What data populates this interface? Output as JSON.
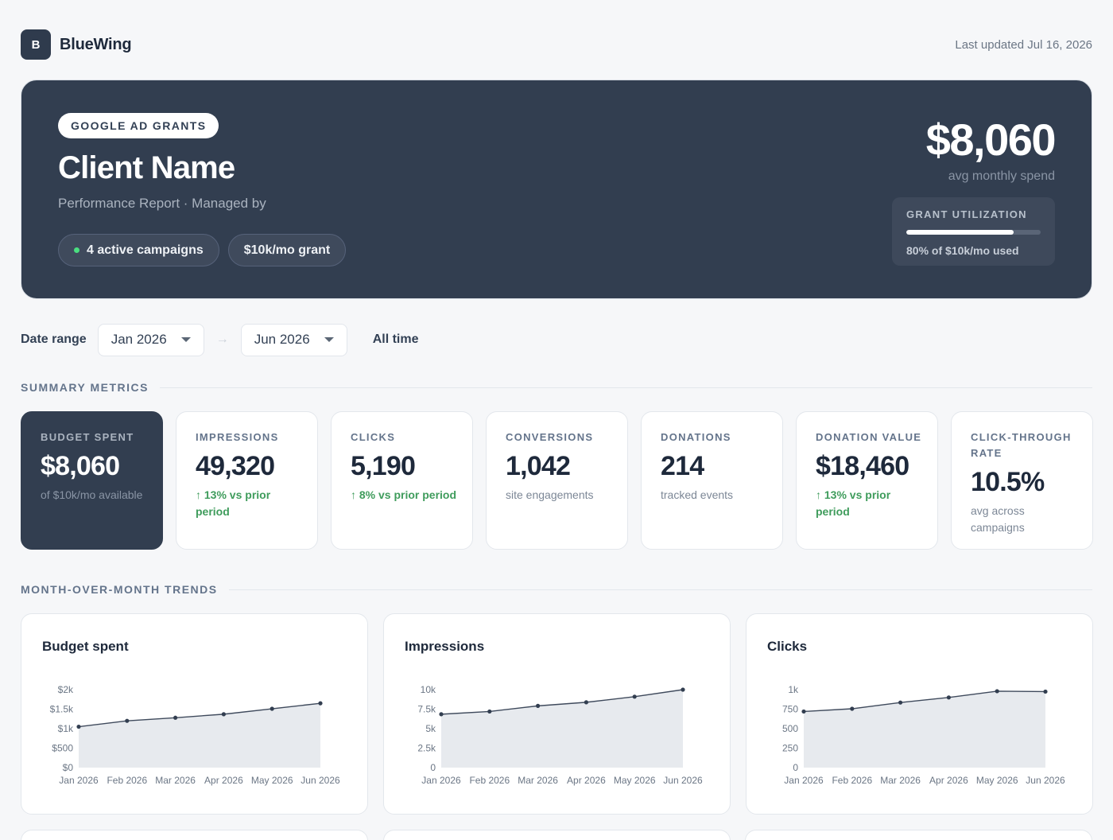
{
  "header": {
    "logo_letter": "B",
    "brand": "BlueWing",
    "last_updated": "Last updated Jul 16, 2026"
  },
  "hero": {
    "eyebrow": "GOOGLE AD GRANTS",
    "client": "Client Name",
    "subtitle": "Performance Report · Managed by",
    "pills": [
      "4 active campaigns",
      "$10k/mo grant"
    ],
    "spend_value": "$8,060",
    "spend_label": "avg monthly spend",
    "utilization": {
      "label": "GRANT UTILIZATION",
      "fraction": 0.8,
      "text": "80% of $10k/mo used"
    }
  },
  "date_range": {
    "label": "Date range",
    "from": "Jan 2026",
    "to": "Jun 2026",
    "all_time": "All time"
  },
  "sections": {
    "summary": "SUMMARY METRICS",
    "trends": "MONTH-OVER-MONTH TRENDS"
  },
  "metrics": [
    {
      "label": "BUDGET SPENT",
      "value": "$8,060",
      "note": "of $10k/mo available",
      "trend": false
    },
    {
      "label": "IMPRESSIONS",
      "value": "49,320",
      "note": "↑ 13% vs prior period",
      "trend": true
    },
    {
      "label": "CLICKS",
      "value": "5,190",
      "note": "↑ 8% vs prior period",
      "trend": true
    },
    {
      "label": "CONVERSIONS",
      "value": "1,042",
      "note": "site engagements",
      "trend": false
    },
    {
      "label": "DONATIONS",
      "value": "214",
      "note": "tracked events",
      "trend": false
    },
    {
      "label": "DONATION VALUE",
      "value": "$18,460",
      "note": "↑ 13% vs prior period",
      "trend": true
    },
    {
      "label": "CLICK-THROUGH RATE",
      "value": "10.5%",
      "note": "avg across campaigns",
      "trend": false
    }
  ],
  "chart_data": [
    {
      "type": "area",
      "title": "Budget spent",
      "categories": [
        "Jan 2026",
        "Feb 2026",
        "Mar 2026",
        "Apr 2026",
        "May 2026",
        "Jun 2026"
      ],
      "values": [
        1050,
        1200,
        1280,
        1370,
        1510,
        1650
      ],
      "ylim": [
        0,
        2000
      ],
      "yticks": [
        "$0",
        "$500",
        "$1k",
        "$1.5k",
        "$2k"
      ],
      "grid": false
    },
    {
      "type": "area",
      "title": "Impressions",
      "categories": [
        "Jan 2026",
        "Feb 2026",
        "Mar 2026",
        "Apr 2026",
        "May 2026",
        "Jun 2026"
      ],
      "values": [
        6850,
        7200,
        7920,
        8380,
        9100,
        10000
      ],
      "ylim": [
        0,
        10000
      ],
      "yticks": [
        "0",
        "2.5k",
        "5k",
        "7.5k",
        "10k"
      ],
      "grid": false
    },
    {
      "type": "area",
      "title": "Clicks",
      "categories": [
        "Jan 2026",
        "Feb 2026",
        "Mar 2026",
        "Apr 2026",
        "May 2026",
        "Jun 2026"
      ],
      "values": [
        720,
        755,
        835,
        900,
        980,
        975
      ],
      "ylim": [
        0,
        1000
      ],
      "yticks": [
        "0",
        "250",
        "500",
        "750",
        "1k"
      ],
      "grid": false
    }
  ]
}
